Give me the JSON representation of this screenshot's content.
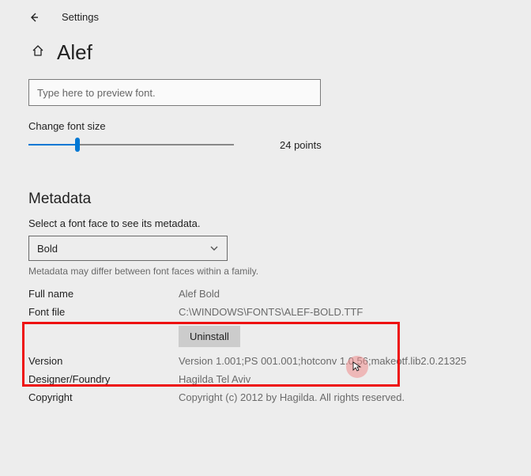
{
  "topbar": {
    "label": "Settings"
  },
  "header": {
    "title": "Alef"
  },
  "preview": {
    "placeholder": "Type here to preview font."
  },
  "slider": {
    "label": "Change font size",
    "value_text": "24 points"
  },
  "metadata": {
    "heading": "Metadata",
    "sublabel": "Select a font face to see its metadata.",
    "selected": "Bold",
    "note": "Metadata may differ between font faces within a family.",
    "rows": {
      "full_name": {
        "key": "Full name",
        "val": "Alef Bold"
      },
      "font_file": {
        "key": "Font file",
        "val": "C:\\WINDOWS\\FONTS\\ALEF-BOLD.TTF"
      },
      "version": {
        "key": "Version",
        "val": "Version 1.001;PS 001.001;hotconv 1.0.56;makeotf.lib2.0.21325"
      },
      "designer": {
        "key": "Designer/Foundry",
        "val": "Hagilda Tel Aviv"
      },
      "copyright": {
        "key": "Copyright",
        "val": "Copyright (c) 2012 by Hagilda. All rights reserved."
      }
    },
    "uninstall": "Uninstall"
  }
}
